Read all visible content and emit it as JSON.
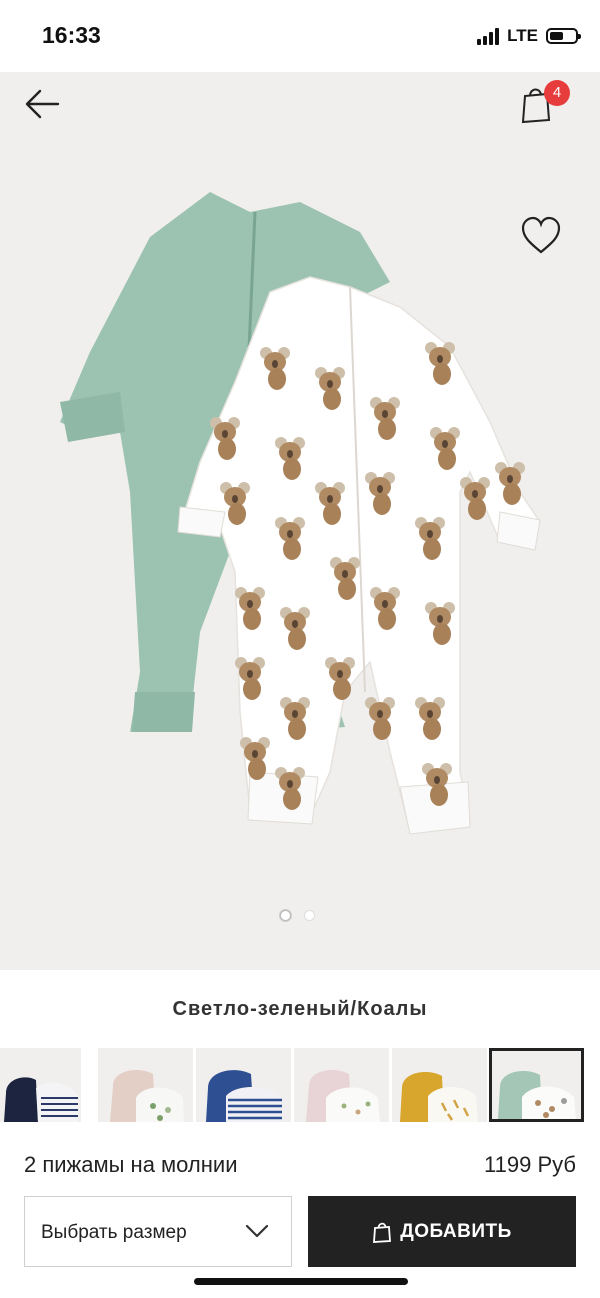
{
  "status": {
    "time": "16:33",
    "network": "LTE"
  },
  "header": {
    "bag_count": "4"
  },
  "product": {
    "color": "Светло-зеленый/Коалы",
    "name": "2 пижамы на молнии",
    "price": "1199 Руб"
  },
  "gallery": {
    "dots_total": 2,
    "active_index": 0
  },
  "swatches": [
    {
      "name": "navy-white-stripe"
    },
    {
      "name": "pink-white-print"
    },
    {
      "name": "blue-stripe"
    },
    {
      "name": "light-pink-print"
    },
    {
      "name": "mustard-print"
    },
    {
      "name": "light-green-koalas",
      "selected": true
    }
  ],
  "actions": {
    "size_label": "Выбрать размер",
    "add_label": "ДОБАВИТЬ"
  },
  "colors": {
    "accent_badge": "#e73c3c",
    "button_dark": "#222222",
    "hero_bg": "#f0efee"
  }
}
